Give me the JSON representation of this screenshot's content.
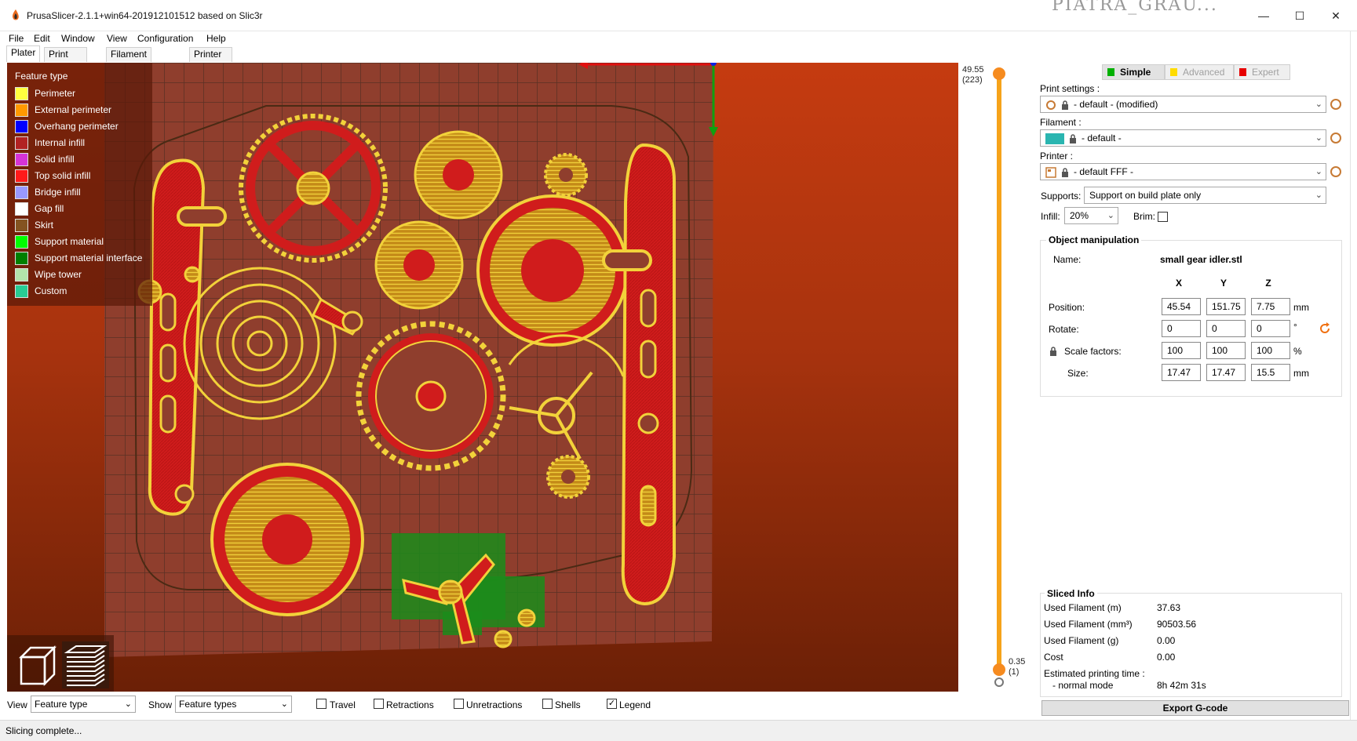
{
  "window": {
    "title": "PrusaSlicer-2.1.1+win64-201912101512 based on Slic3r",
    "minimize": "—",
    "maximize": "☐",
    "close": "✕",
    "background_text": "PIATRA_GRAU..."
  },
  "menu": [
    "File",
    "Edit",
    "Window",
    "View",
    "Configuration",
    "Help"
  ],
  "tabs": [
    "Plater",
    "Print Settings",
    "Filament Settings",
    "Printer Settings"
  ],
  "legend": {
    "title": "Feature type",
    "items": [
      {
        "label": "Perimeter",
        "color": "#ffff3f"
      },
      {
        "label": "External perimeter",
        "color": "#ff9900"
      },
      {
        "label": "Overhang perimeter",
        "color": "#0000ff"
      },
      {
        "label": "Internal infill",
        "color": "#b22222"
      },
      {
        "label": "Solid infill",
        "color": "#d633d6"
      },
      {
        "label": "Top solid infill",
        "color": "#ff1a1a"
      },
      {
        "label": "Bridge infill",
        "color": "#9999ff"
      },
      {
        "label": "Gap fill",
        "color": "#ffffff"
      },
      {
        "label": "Skirt",
        "color": "#845321"
      },
      {
        "label": "Support material",
        "color": "#00ff00"
      },
      {
        "label": "Support material interface",
        "color": "#008000"
      },
      {
        "label": "Wipe tower",
        "color": "#b3e3ab"
      },
      {
        "label": "Custom",
        "color": "#28cc94"
      }
    ]
  },
  "layer_slider": {
    "top_value": "49.55",
    "top_layer": "(223)",
    "bottom_value": "0.35",
    "bottom_layer": "(1)"
  },
  "mode": {
    "simple": "Simple",
    "advanced": "Advanced",
    "expert": "Expert",
    "simple_color": "#00b000",
    "advanced_color": "#ffdc00",
    "expert_color": "#e70000"
  },
  "sidebar": {
    "print_settings_label": "Print settings :",
    "print_settings_value": "- default - (modified)",
    "filament_label": "Filament :",
    "filament_value": "- default -",
    "filament_color": "#2ab5b0",
    "printer_label": "Printer :",
    "printer_value": "- default FFF -",
    "supports_label": "Supports:",
    "supports_value": "Support on build plate only",
    "infill_label": "Infill:",
    "infill_value": "20%",
    "brim_label": "Brim:"
  },
  "object_manipulation": {
    "title": "Object manipulation",
    "name_label": "Name:",
    "name_value": "small gear idler.stl",
    "axes": [
      "X",
      "Y",
      "Z"
    ],
    "position_label": "Position:",
    "position": [
      "45.54",
      "151.75",
      "7.75"
    ],
    "position_unit": "mm",
    "rotate_label": "Rotate:",
    "rotate": [
      "0",
      "0",
      "0"
    ],
    "rotate_unit": "°",
    "scale_label": "Scale factors:",
    "scale": [
      "100",
      "100",
      "100"
    ],
    "scale_unit": "%",
    "size_label": "Size:",
    "size": [
      "17.47",
      "17.47",
      "15.5"
    ],
    "size_unit": "mm"
  },
  "sliced_info": {
    "title": "Sliced Info",
    "rows": [
      {
        "label": "Used Filament (m)",
        "value": "37.63"
      },
      {
        "label": "Used Filament (mm³)",
        "value": "90503.56"
      },
      {
        "label": "Used Filament (g)",
        "value": "0.00"
      },
      {
        "label": "Cost",
        "value": "0.00"
      }
    ],
    "print_time_label": "Estimated printing time :",
    "normal_mode_label": "- normal mode",
    "normal_mode_value": "8h 42m 31s"
  },
  "export_button": "Export G-code",
  "bottom_toolbar": {
    "view_label": "View",
    "view_value": "Feature type",
    "show_label": "Show",
    "show_value": "Feature types",
    "checks": [
      {
        "label": "Travel",
        "checked": false
      },
      {
        "label": "Retractions",
        "checked": false
      },
      {
        "label": "Unretractions",
        "checked": false
      },
      {
        "label": "Shells",
        "checked": false
      },
      {
        "label": "Legend",
        "checked": true
      }
    ]
  },
  "status": "Slicing complete..."
}
